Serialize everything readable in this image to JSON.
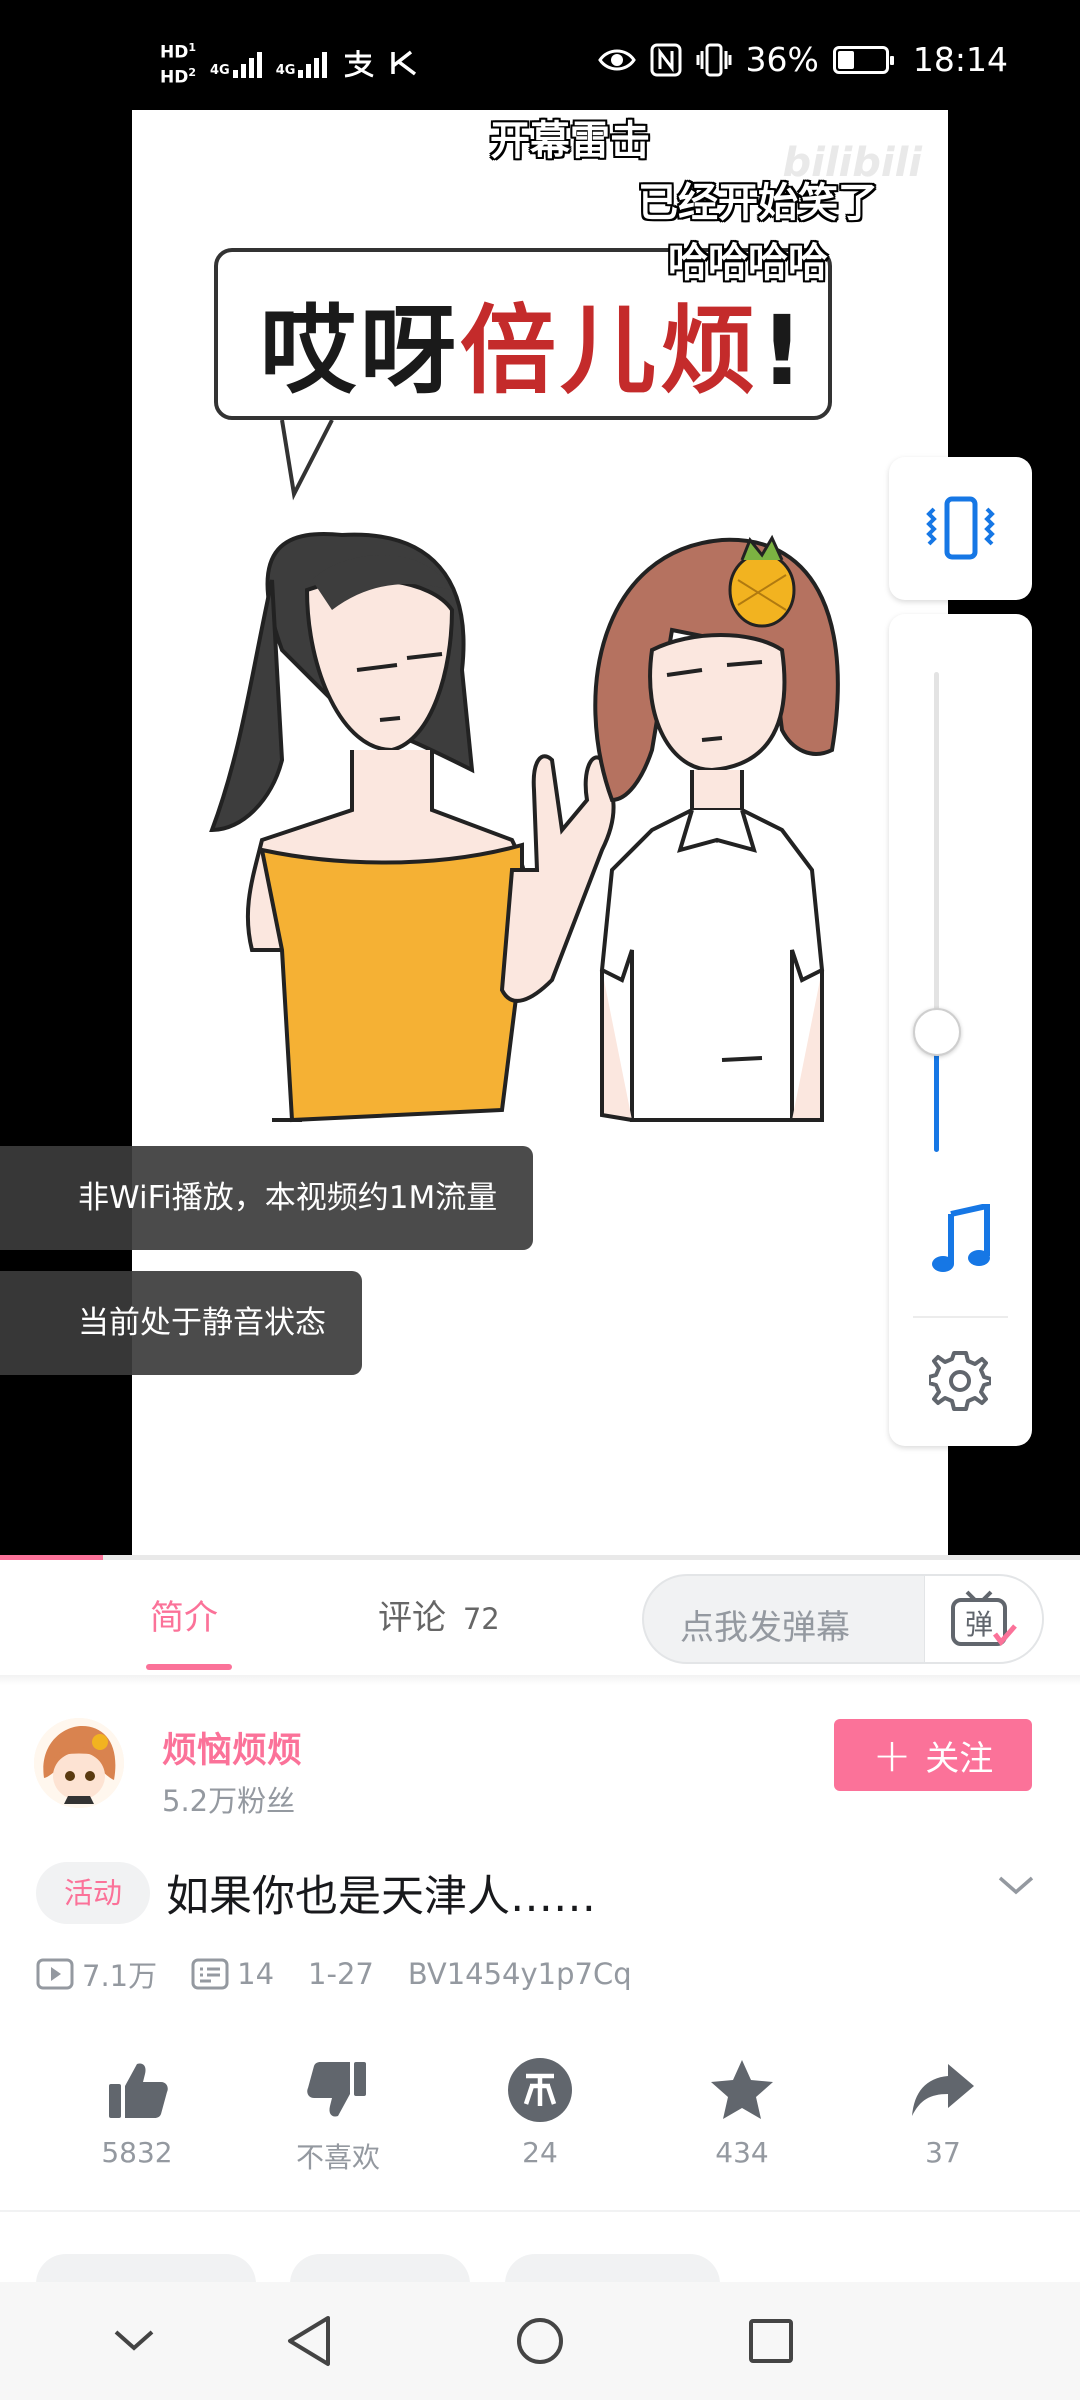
{
  "status_bar": {
    "hd1": "HD",
    "hd1_index": "1",
    "hd2": "HD",
    "hd2_index": "2",
    "net1": "4G",
    "net2": "4G",
    "icons": [
      "alipay-icon",
      "download-icon",
      "eye-icon",
      "nfc-icon",
      "vibrate-icon"
    ],
    "battery": "36%",
    "time": "18:14"
  },
  "video": {
    "watermark": "bilibili",
    "danmaku": [
      "开幕雷击",
      "已经开始笑了",
      "哈哈哈哈"
    ],
    "bubble_text_dark": "哎呀",
    "bubble_text_red": "倍儿烦",
    "bubble_text_mark": "!",
    "toasts": [
      "非WiFi播放，本视频约1M流量",
      "当前处于静音状态"
    ],
    "volume_level": 0.25,
    "progress": 0.095
  },
  "tabs": {
    "intro": "简介",
    "comments": "评论",
    "comments_count": "72",
    "danmaku_placeholder": "点我发弹幕",
    "danmaku_button": "弹"
  },
  "uploader": {
    "name": "烦恼烦烦",
    "fans": "5.2万粉丝",
    "follow_label": "关注",
    "follow_plus": "+"
  },
  "video_info": {
    "tag": "活动",
    "title": "如果你也是天津人……",
    "views": "7.1万",
    "danmaku_count": "14",
    "date": "1-27",
    "bvid": "BV1454y1p7Cq"
  },
  "actions": {
    "like": "5832",
    "dislike": "不喜欢",
    "coin": "24",
    "favorite": "434",
    "share": "37"
  },
  "colors": {
    "accent": "#fb7299",
    "control_blue": "#1677e5",
    "icon_gray": "#61666d",
    "meta_gray": "#9499a0"
  }
}
